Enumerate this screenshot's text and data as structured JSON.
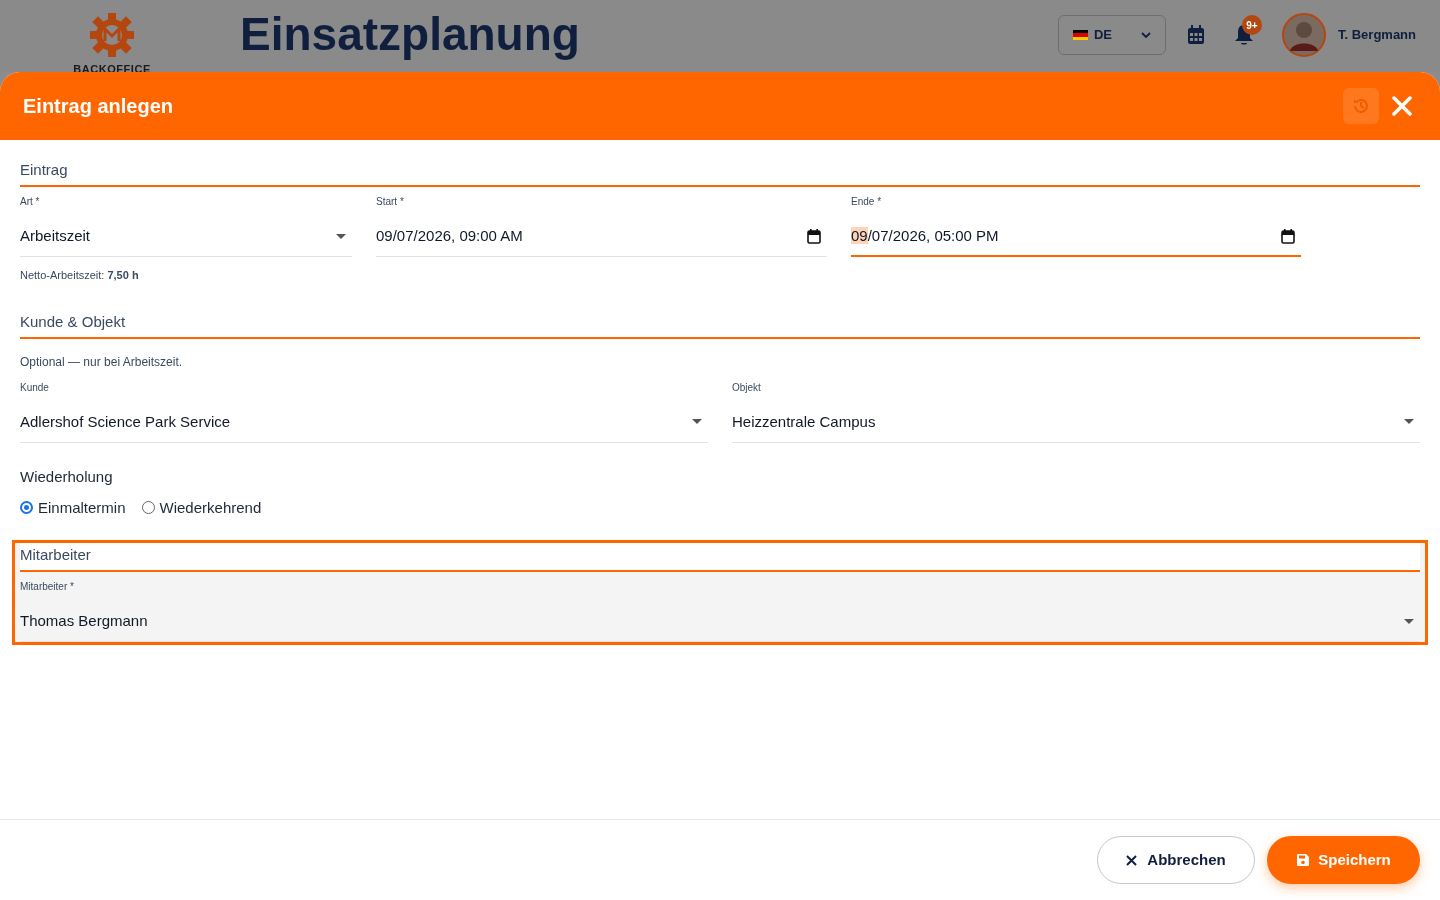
{
  "background": {
    "logo_text": "BACKOFFICE",
    "page_title": "Einsatzplanung",
    "language": "DE",
    "notification_badge": "9+",
    "user_name": "T. Bergmann"
  },
  "dialog": {
    "title": "Eintrag anlegen",
    "history_button": {
      "disabled": true
    },
    "sections": [
      {
        "kind": "fields",
        "title": "Eintrag",
        "highlighted": false,
        "fields": [
          {
            "kind": "select",
            "label": "Art *",
            "value": "Arbeitszeit",
            "focused": false
          },
          {
            "kind": "datetime",
            "label": "Start *",
            "value": "09/07/2026, 09:00 AM",
            "focused": false
          },
          {
            "kind": "datetime",
            "label": "Ende *",
            "value": "09/07/2026, 05:00 PM",
            "focused": true
          }
        ],
        "note_below": "Netto-Arbeitszeit: **7,50 h**"
      },
      {
        "kind": "fields",
        "title": "Kunde & Objekt",
        "highlighted": false,
        "note_above": "Optional — nur bei Arbeitszeit.",
        "fields": [
          {
            "kind": "select",
            "label": "Kunde",
            "value": "Adlershof Science Park Service",
            "focused": false
          },
          {
            "kind": "select",
            "label": "Objekt",
            "value": "Heizzentrale Campus",
            "focused": false
          }
        ]
      },
      {
        "kind": "radios",
        "title": "Wiederholung",
        "options": [
          {
            "label": "Einmaltermin",
            "selected": true
          },
          {
            "label": "Wiederkehrend",
            "selected": false
          }
        ]
      },
      {
        "kind": "fields",
        "title": "Mitarbeiter",
        "highlighted": true,
        "fields": [
          {
            "kind": "select",
            "label": "Mitarbeiter *",
            "value": "Thomas Bergmann",
            "focused": false
          }
        ]
      }
    ],
    "buttons": [
      {
        "kind": "secondary",
        "label": "Abbrechen"
      },
      {
        "kind": "primary",
        "label": "Speichern"
      }
    ]
  }
}
